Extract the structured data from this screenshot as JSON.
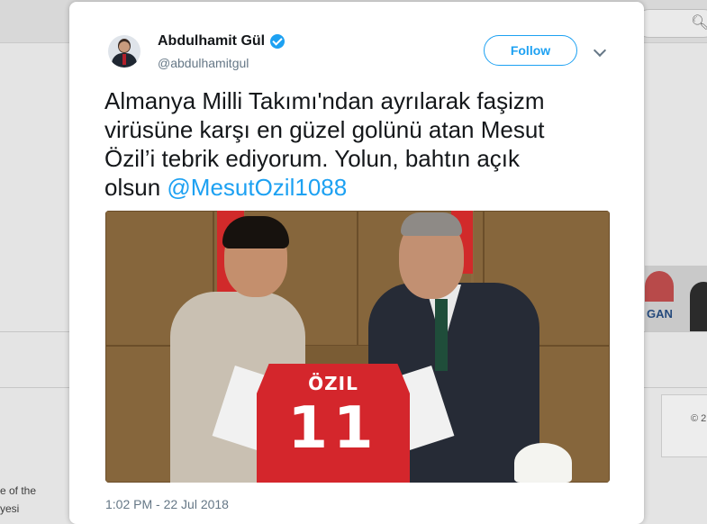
{
  "background": {
    "left_text": [
      "e of the",
      "yesi"
    ],
    "right_card_text": "© 2",
    "logo_fragment": "GAN"
  },
  "tweet": {
    "author_name": "Abdulhamit Gül",
    "author_handle": "@abdulhamitgul",
    "follow_label": "Follow",
    "text_lines": [
      "Almanya Milli Takımı'ndan ayrılarak faşizm",
      "virüsüne karşı en güzel golünü atan Mesut",
      "Özil’i tebrik ediyorum. Yolun, bahtın açık",
      "olsun "
    ],
    "mention": "@MesutOzil1088",
    "photo": {
      "jersey_name": "ÖZIL",
      "jersey_number": "11"
    },
    "timestamp": "1:02 PM - 22 Jul 2018"
  },
  "colors": {
    "accent": "#1da1f2",
    "text": "#14171a",
    "secondary": "#657786"
  },
  "icons": [
    "verified-badge-icon",
    "chevron-down-icon",
    "search-icon"
  ]
}
